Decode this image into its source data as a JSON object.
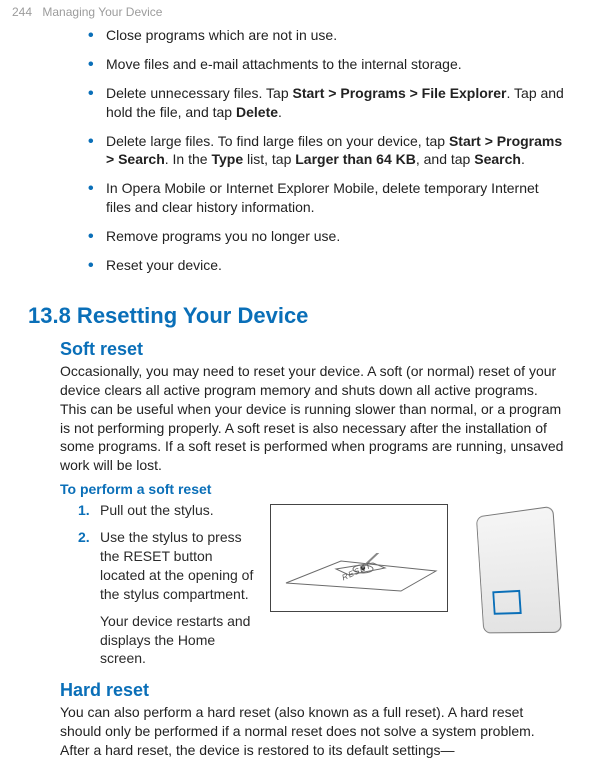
{
  "header": {
    "page_number": "244",
    "chapter_title": "Managing Your Device"
  },
  "tips": {
    "b1": "Close programs which are not in use.",
    "b2": "Move files and e-mail attachments to the internal storage.",
    "b3_pre": "Delete unnecessary files. Tap ",
    "b3_path": "Start > Programs > File Explorer",
    "b3_mid": ". Tap and hold the file, and tap ",
    "b3_delete": "Delete",
    "b3_end": ".",
    "b4_pre": "Delete large files. To find large files on your device, tap ",
    "b4_path": "Start > Programs > Search",
    "b4_mid1": ". In the ",
    "b4_type": "Type",
    "b4_mid2": " list, tap ",
    "b4_larger": "Larger than 64 KB",
    "b4_mid3": ", and tap ",
    "b4_search": "Search",
    "b4_end": ".",
    "b5": "In Opera Mobile or Internet Explorer Mobile, delete temporary Internet files and clear history information.",
    "b6": "Remove programs you no longer use.",
    "b7": "Reset your device."
  },
  "section": {
    "number_title": "13.8  Resetting Your Device"
  },
  "soft_reset": {
    "heading": "Soft reset",
    "para": "Occasionally, you may need to reset your device. A soft (or normal) reset of your device clears all active program memory and shuts down all active programs. This can be useful when your device is running slower than normal, or a program is not performing properly. A soft reset is also necessary after the installation of some programs. If a soft reset is performed when programs are running, unsaved work will be lost.",
    "perform_heading": "To perform a soft reset",
    "step1_num": "1.",
    "step1": "Pull out the stylus.",
    "step2_num": "2.",
    "step2": "Use the stylus to press the RESET button located at the opening of the stylus compartment.",
    "step2_after": "Your device restarts and displays the Home screen.",
    "reset_label": "RESET"
  },
  "hard_reset": {
    "heading": "Hard reset",
    "para": "You can also perform a hard reset (also known as a full reset). A hard reset should only be performed if a normal reset does not solve a system problem. After a hard reset, the device is restored to its default settings—"
  }
}
